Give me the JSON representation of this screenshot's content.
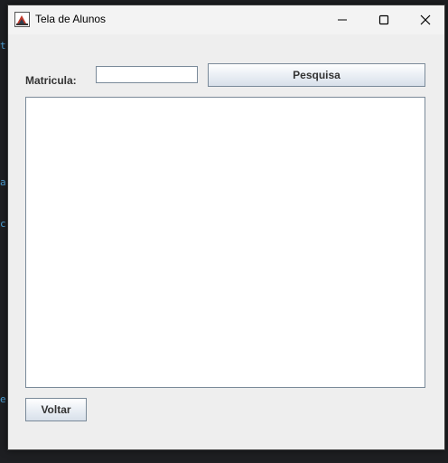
{
  "background": {
    "code_glyphs": [
      "t",
      "a",
      "c",
      "e"
    ]
  },
  "window": {
    "title": "Tela de Alunos",
    "controls": {
      "minimize": "minimize-icon",
      "maximize": "maximize-icon",
      "close": "close-icon"
    }
  },
  "form": {
    "matricula_label": "Matricula:",
    "matricula_value": "",
    "search_button": "Pesquisa",
    "results_text": "",
    "back_button": "Voltar"
  },
  "colors": {
    "window_bg": "#eeeeee",
    "border": "#7a8a99",
    "label_text": "#333333"
  }
}
